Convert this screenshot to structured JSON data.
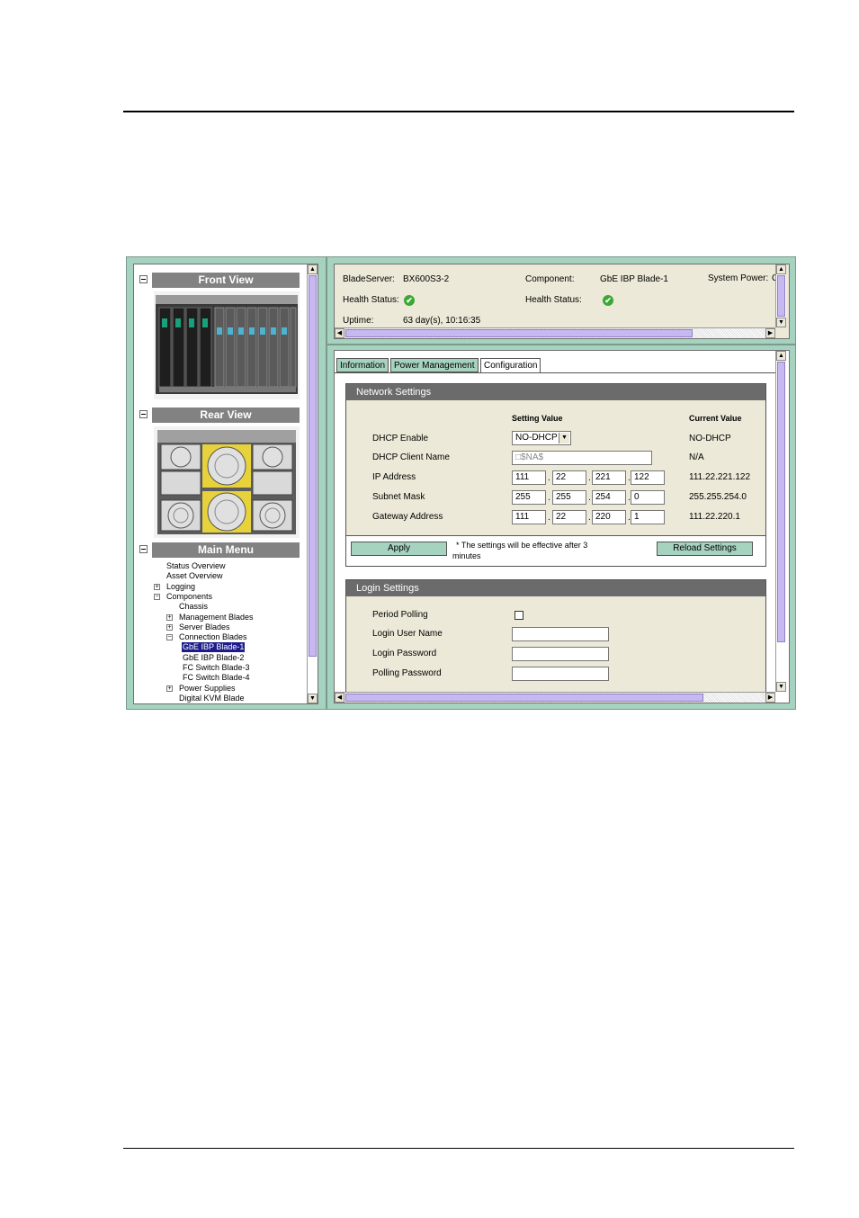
{
  "left_panel": {
    "front_view_label": "Front View",
    "rear_view_label": "Rear View",
    "main_menu_label": "Main Menu",
    "menu": {
      "status_overview": "Status Overview",
      "asset_overview": "Asset Overview",
      "logging": "Logging",
      "components": "Components",
      "chassis": "Chassis",
      "management_blades": "Management Blades",
      "server_blades": "Server Blades",
      "connection_blades": "Connection Blades",
      "gbe_ibp_1": "GbE IBP Blade-1",
      "gbe_ibp_2": "GbE IBP Blade-2",
      "fc_switch_3": "FC Switch Blade-3",
      "fc_switch_4": "FC Switch Blade-4",
      "power_supplies": "Power Supplies",
      "digital_kvm": "Digital KVM Blade"
    },
    "toggles": {
      "plus": "+",
      "minus": "−"
    }
  },
  "status_panel": {
    "bladeserver_label": "BladeServer:",
    "bladeserver_value": "BX600S3-2",
    "component_label": "Component:",
    "component_value": "GbE IBP Blade-1",
    "system_power_label": "System Power:",
    "system_power_value": "C",
    "health_status_label_1": "Health Status:",
    "health_status_label_2": "Health Status:",
    "health_icon": "✔",
    "uptime_label": "Uptime:",
    "uptime_value": "63 day(s), 10:16:35"
  },
  "tabs": [
    {
      "label": "Information",
      "active": false
    },
    {
      "label": "Power Management",
      "active": false
    },
    {
      "label": "Configuration",
      "active": true
    }
  ],
  "network_settings": {
    "title": "Network Settings",
    "col_setting": "Setting Value",
    "col_current": "Current Value",
    "dhcp_enable_label": "DHCP Enable",
    "dhcp_enable_value": "NO-DHCP",
    "dhcp_enable_current": "NO-DHCP",
    "dhcp_client_label": "DHCP Client Name",
    "dhcp_client_value": "□$NA$",
    "dhcp_client_current": "N/A",
    "ip_label": "IP Address",
    "ip_octets": [
      "111",
      "22",
      "221",
      "122"
    ],
    "ip_current": "111.22.221.122",
    "mask_label": "Subnet Mask",
    "mask_octets": [
      "255",
      "255",
      "254",
      "0"
    ],
    "mask_current": "255.255.254.0",
    "gateway_label": "Gateway Address",
    "gateway_octets": [
      "111",
      "22",
      "220",
      "1"
    ],
    "gateway_current": "111.22.220.1",
    "apply_label": "Apply",
    "note_line1": "* The settings will be effective after 3",
    "note_line2": "minutes",
    "reload_label": "Reload Settings"
  },
  "login_settings": {
    "title": "Login Settings",
    "period_polling_label": "Period Polling",
    "login_user_label": "Login User Name",
    "login_password_label": "Login Password",
    "polling_password_label": "Polling Password"
  },
  "colors": {
    "frame_green": "#a6d2c0",
    "scroll_lilac": "#c7b8f0",
    "selection_navy": "#1c1c8c",
    "health_ok": "#3aa832"
  }
}
